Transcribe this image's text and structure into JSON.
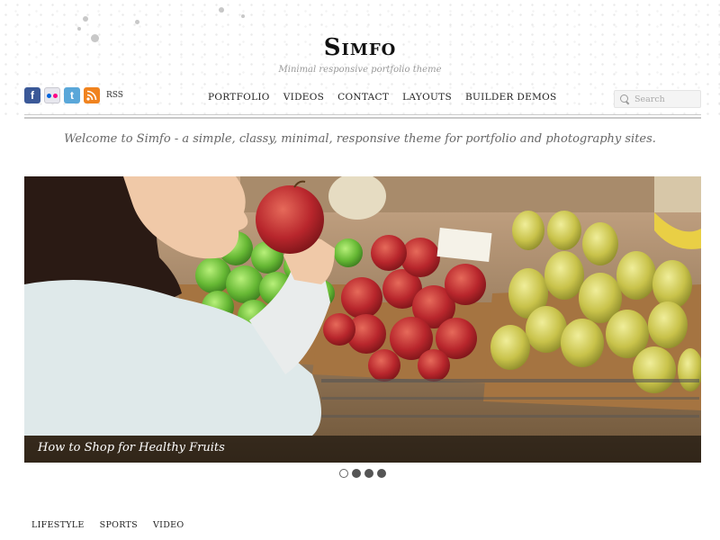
{
  "site": {
    "title": "Simfo",
    "tagline": "Minimal responsive portfolio theme"
  },
  "social": {
    "icons": [
      "facebook-icon",
      "flickr-icon",
      "twitter-icon",
      "rss-icon"
    ],
    "rss_label": "RSS"
  },
  "nav": {
    "items": [
      "PORTFOLIO",
      "VIDEOS",
      "CONTACT",
      "LAYOUTS",
      "BUILDER DEMOS"
    ]
  },
  "search": {
    "placeholder": "Search"
  },
  "welcome": {
    "text": "Welcome to Simfo - a simple, classy, minimal, responsive theme for portfolio and photography sites."
  },
  "slider": {
    "caption": "How to Shop for Healthy Fruits",
    "slide_count": 4,
    "active_slide": 1
  },
  "categories": {
    "items": [
      "LIFESTYLE",
      "SPORTS",
      "VIDEO"
    ]
  },
  "colors": {
    "facebook": "#3b5998",
    "twitter": "#5aa7d9",
    "rss": "#f0831f",
    "caption_bar": "rgba(0,0,0,0.55)"
  }
}
